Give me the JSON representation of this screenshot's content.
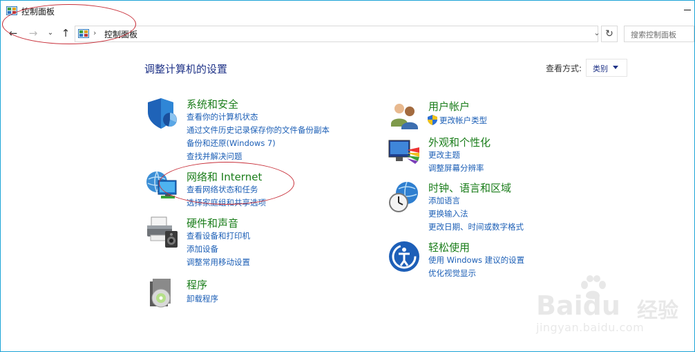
{
  "window": {
    "title": "控制面板"
  },
  "address": {
    "path": "控制面板",
    "search_placeholder": "搜索控制面板"
  },
  "main": {
    "heading": "调整计算机的设置",
    "view_by_label": "查看方式:",
    "view_by_value": "类别"
  },
  "categories_left": [
    {
      "title": "系统和安全",
      "links": [
        "查看你的计算机状态",
        "通过文件历史记录保存你的文件备份副本",
        "备份和还原(Windows 7)",
        "查找并解决问题"
      ]
    },
    {
      "title": "网络和 Internet",
      "links": [
        "查看网络状态和任务",
        "选择家庭组和共享选项"
      ]
    },
    {
      "title": "硬件和声音",
      "links": [
        "查看设备和打印机",
        "添加设备",
        "调整常用移动设置"
      ]
    },
    {
      "title": "程序",
      "links": [
        "卸载程序"
      ]
    }
  ],
  "categories_right": [
    {
      "title": "用户帐户",
      "links": [
        "更改帐户类型"
      ]
    },
    {
      "title": "外观和个性化",
      "links": [
        "更改主题",
        "调整屏幕分辨率"
      ]
    },
    {
      "title": "时钟、语言和区域",
      "links": [
        "添加语言",
        "更换输入法",
        "更改日期、时间或数字格式"
      ]
    },
    {
      "title": "轻松使用",
      "links": [
        "使用 Windows 建议的设置",
        "优化视觉显示"
      ]
    }
  ],
  "watermark": {
    "brand": "Baidu",
    "cn": "经验",
    "url": "jingyan.baidu.com"
  },
  "colors": {
    "category_title": "#1a7d1a",
    "link": "#1c5fb6",
    "heading": "#1e3287",
    "annotation": "#c8303a"
  }
}
